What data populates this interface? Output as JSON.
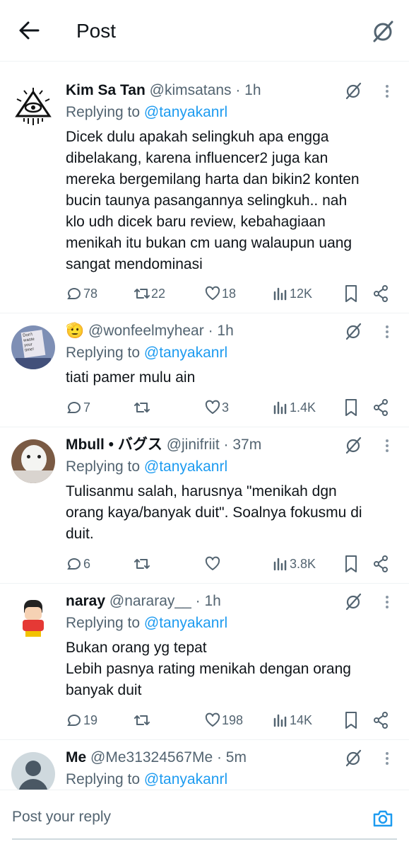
{
  "header": {
    "title": "Post",
    "back_icon": "arrow-left-icon",
    "grok_icon": "grok-icon"
  },
  "colors": {
    "accent": "#1d9bf0",
    "text": "#0f1419",
    "muted": "#536471",
    "divider": "#eff3f4"
  },
  "replies": [
    {
      "name": "Kim Sa Tan",
      "handle": "@kimsatans",
      "time": "· 1h",
      "replying_label": "Replying to",
      "replying_to": "@tanyakanrl",
      "text": "Dicek dulu apakah selingkuh apa engga\ndibelakang, karena influencer2 juga kan\nmereka bergemilang harta dan bikin2 konten\nbucin taunya pasangannya selingkuh.. nah\nklo udh dicek baru review, kebahagiaan\nmenikah itu bukan cm uang walaupun uang\nsangat mendominasi",
      "stats": {
        "replies": "78",
        "reposts": "22",
        "likes": "18",
        "views": "12K"
      }
    },
    {
      "name": "",
      "name_emoji": "🫡",
      "handle": "@wonfeelmyhear",
      "time": "· 1h",
      "replying_label": "Replying to",
      "replying_to": "@tanyakanrl",
      "text": "tiati pamer mulu ain",
      "avatar_text": "Don't waste your time!",
      "stats": {
        "replies": "7",
        "reposts": "",
        "likes": "3",
        "views": "1.4K"
      }
    },
    {
      "name": "Mbull • バグス",
      "handle": "@jinifriit",
      "time": "· 37m",
      "replying_label": "Replying to",
      "replying_to": "@tanyakanrl",
      "text": "Tulisanmu salah, harusnya \"menikah dgn\norang kaya/banyak duit\". Soalnya fokusmu di\nduit.",
      "stats": {
        "replies": "6",
        "reposts": "",
        "likes": "",
        "views": "3.8K"
      }
    },
    {
      "name": "naray",
      "handle": "@nararay__",
      "time": "· 1h",
      "replying_label": "Replying to",
      "replying_to": "@tanyakanrl",
      "text": "Bukan orang yg tepat\nLebih pasnya rating menikah dengan orang\nbanyak duit",
      "stats": {
        "replies": "19",
        "reposts": "",
        "likes": "198",
        "views": "14K"
      }
    },
    {
      "name": "Me",
      "handle": "@Me31324567Me",
      "time": "· 5m",
      "replying_label": "Replying to",
      "replying_to": "@tanyakanrl"
    }
  ],
  "composer": {
    "placeholder": "Post your reply",
    "camera_icon": "camera-icon"
  }
}
